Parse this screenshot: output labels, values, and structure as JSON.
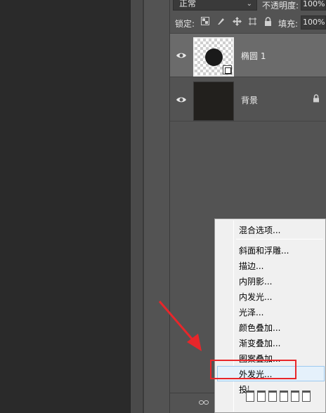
{
  "layers_panel": {
    "blend_mode": "正常",
    "opacity_label": "不透明度:",
    "opacity_value": "100%",
    "lock_label": "锁定:",
    "fill_label": "填充:",
    "fill_value": "100%",
    "layers": [
      {
        "name": "椭圆 1",
        "selected": true,
        "visible": true,
        "thumbnail": "ellipse-shape"
      },
      {
        "name": "背景",
        "selected": false,
        "visible": true,
        "locked": true,
        "thumbnail": "dark-fill"
      }
    ]
  },
  "context_menu": {
    "items": [
      "混合选项...",
      "斜面和浮雕...",
      "描边...",
      "内阴影...",
      "内发光...",
      "光泽...",
      "颜色叠加...",
      "渐变叠加...",
      "图案叠加...",
      "外发光...",
      "投影..."
    ],
    "highlighted": "外发光..."
  },
  "bottom_bar": {
    "fx_label": "fx"
  },
  "colors": {
    "panel_bg": "#535353",
    "selected_row": "#6b6b6b",
    "menu_bg": "#f0f0f0",
    "highlight_box": "#e8262a",
    "arrow": "#e8262a"
  }
}
